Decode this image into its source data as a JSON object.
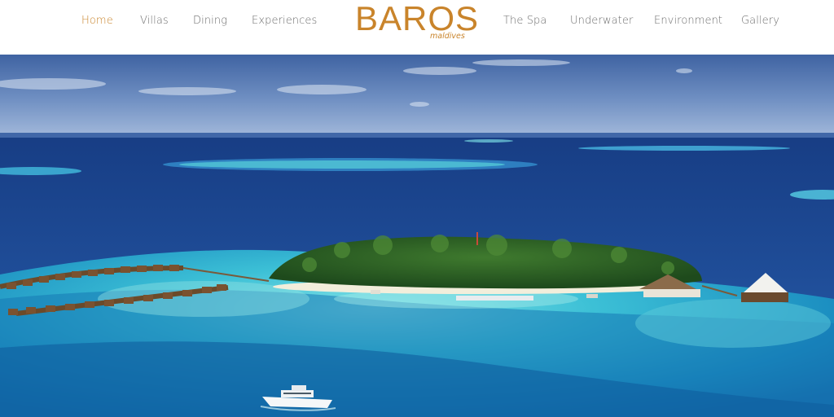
{
  "nav": {
    "left": [
      {
        "label": "Home",
        "active": true
      },
      {
        "label": "Villas"
      },
      {
        "label": "Dining"
      },
      {
        "label": "Experiences"
      }
    ],
    "right": [
      {
        "label": "The Spa"
      },
      {
        "label": "Underwater"
      },
      {
        "label": "Environment"
      },
      {
        "label": "Gallery"
      }
    ]
  },
  "logo": {
    "word": "BAROS",
    "sub": "maldives"
  },
  "colors": {
    "accent": "#c9842b",
    "nav_text": "#6d6d6d",
    "sky": "#5c7fb6",
    "ocean": "#1d4a93",
    "lagoon": "#37b3cd"
  }
}
